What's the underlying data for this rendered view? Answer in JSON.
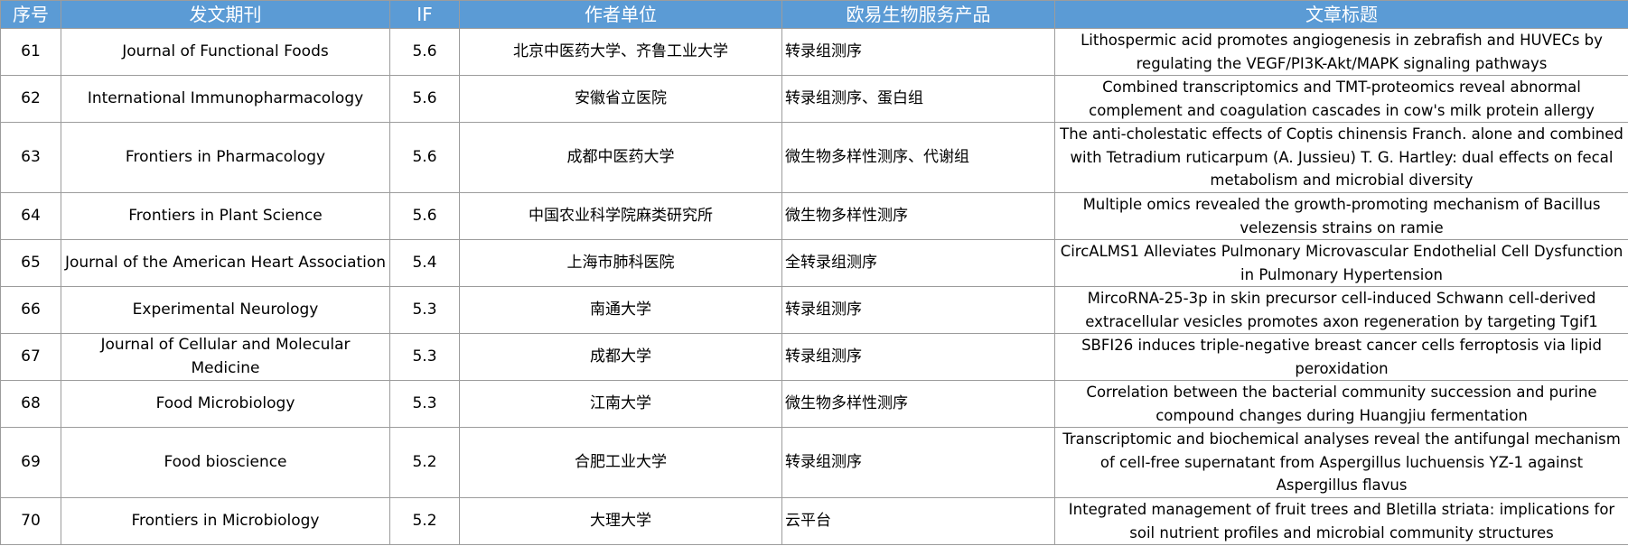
{
  "table": {
    "headers": [
      "序号",
      "发文期刊",
      "IF",
      "作者单位",
      "欧易生物服务产品",
      "文章标题"
    ],
    "rows": [
      {
        "no": "61",
        "journal": "Journal of Functional Foods",
        "if": "5.6",
        "affiliation": "北京中医药大学、齐鲁工业大学",
        "product": "转录组测序",
        "title": "Lithospermic acid promotes angiogenesis in zebrafish and HUVECs by regulating the VEGF/PI3K-Akt/MAPK signaling pathways"
      },
      {
        "no": "62",
        "journal": "International Immunopharmacology",
        "if": "5.6",
        "affiliation": "安徽省立医院",
        "product": "转录组测序、蛋白组",
        "title": "Combined transcriptomics and TMT-proteomics reveal abnormal complement and coagulation cascades in cow's milk protein allergy"
      },
      {
        "no": "63",
        "journal": "Frontiers in Pharmacology",
        "if": "5.6",
        "affiliation": "成都中医药大学",
        "product": "微生物多样性测序、代谢组",
        "title": "The anti-cholestatic effects of Coptis chinensis Franch. alone and combined with Tetradium ruticarpum (A. Jussieu) T. G. Hartley: dual effects on fecal metabolism and microbial diversity"
      },
      {
        "no": "64",
        "journal": "Frontiers in Plant Science",
        "if": "5.6",
        "affiliation": "中国农业科学院麻类研究所",
        "product": "微生物多样性测序",
        "title": "Multiple omics revealed the growth-promoting mechanism of Bacillus velezensis strains on ramie"
      },
      {
        "no": "65",
        "journal": "Journal of the American Heart Association",
        "if": "5.4",
        "affiliation": "上海市肺科医院",
        "product": "全转录组测序",
        "title": "CircALMS1 Alleviates Pulmonary Microvascular Endothelial Cell Dysfunction in Pulmonary Hypertension"
      },
      {
        "no": "66",
        "journal": "Experimental Neurology",
        "if": "5.3",
        "affiliation": "南通大学",
        "product": "转录组测序",
        "title": "MircoRNA-25-3p in skin precursor cell-induced Schwann cell-derived extracellular vesicles promotes axon regeneration by targeting Tgif1"
      },
      {
        "no": "67",
        "journal": "Journal of Cellular and Molecular Medicine",
        "if": "5.3",
        "affiliation": "成都大学",
        "product": "转录组测序",
        "title": "SBFI26 induces triple-negative breast cancer cells ferroptosis via lipid peroxidation"
      },
      {
        "no": "68",
        "journal": "Food Microbiology",
        "if": "5.3",
        "affiliation": "江南大学",
        "product": "微生物多样性测序",
        "title": "Correlation between the bacterial community succession and purine compound changes during Huangjiu fermentation"
      },
      {
        "no": "69",
        "journal": "Food bioscience",
        "if": "5.2",
        "affiliation": "合肥工业大学",
        "product": "转录组测序",
        "title": "Transcriptomic and biochemical analyses reveal the antifungal mechanism of cell-free supernatant from Aspergillus luchuensis YZ-1 against Aspergillus flavus"
      },
      {
        "no": "70",
        "journal": "Frontiers in Microbiology",
        "if": "5.2",
        "affiliation": "大理大学",
        "product": "云平台",
        "title": "Integrated management of fruit trees and Bletilla striata: implications for soil nutrient profiles and microbial community structures"
      }
    ]
  }
}
